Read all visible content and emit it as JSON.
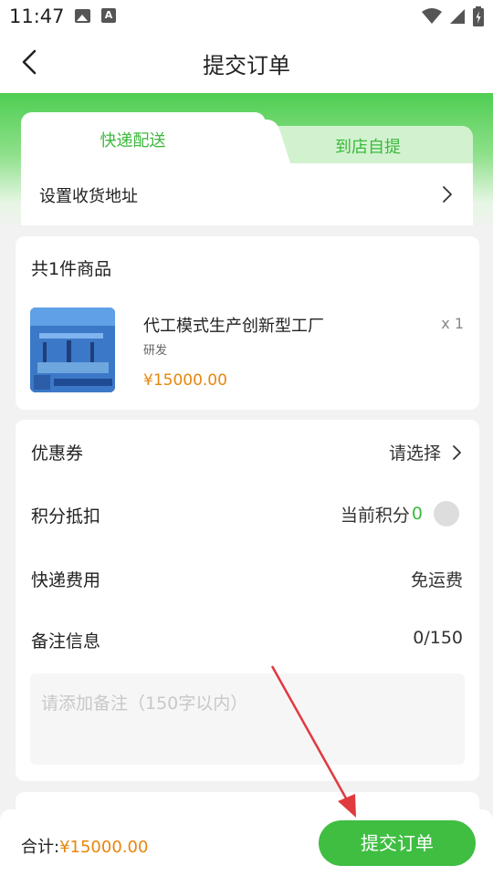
{
  "status_bar": {
    "time": "11:47",
    "a_glyph": "A"
  },
  "header": {
    "title": "提交订单"
  },
  "delivery_tabs": [
    {
      "label": "快递配送",
      "active": true
    },
    {
      "label": "到店自提",
      "active": false
    }
  ],
  "address": {
    "label": "设置收货地址"
  },
  "goods": {
    "count_label": "共1件商品",
    "items": [
      {
        "name": "代工模式生产创新型工厂",
        "tag": "研发",
        "price": "¥15000.00",
        "qty": "x 1"
      }
    ]
  },
  "options": {
    "coupon": {
      "label": "优惠券",
      "value": "请选择"
    },
    "points": {
      "label": "积分抵扣",
      "prefix": "当前积分",
      "value": "0"
    },
    "shipping": {
      "label": "快递费用",
      "value": "免运费"
    },
    "remark": {
      "label": "备注信息",
      "counter": "0/150",
      "placeholder": "请添加备注（150字以内）"
    }
  },
  "footer": {
    "total_label": "合计:",
    "total_value": "¥15000.00",
    "submit_label": "提交订单"
  },
  "colors": {
    "accent": "#3fbe42",
    "price": "#e8860d",
    "annotation_arrow": "#e0393e"
  },
  "icons": [
    "photo-icon",
    "a-icon",
    "wifi-icon",
    "signal-icon",
    "battery-icon",
    "back-icon",
    "chevron-right-icon"
  ]
}
